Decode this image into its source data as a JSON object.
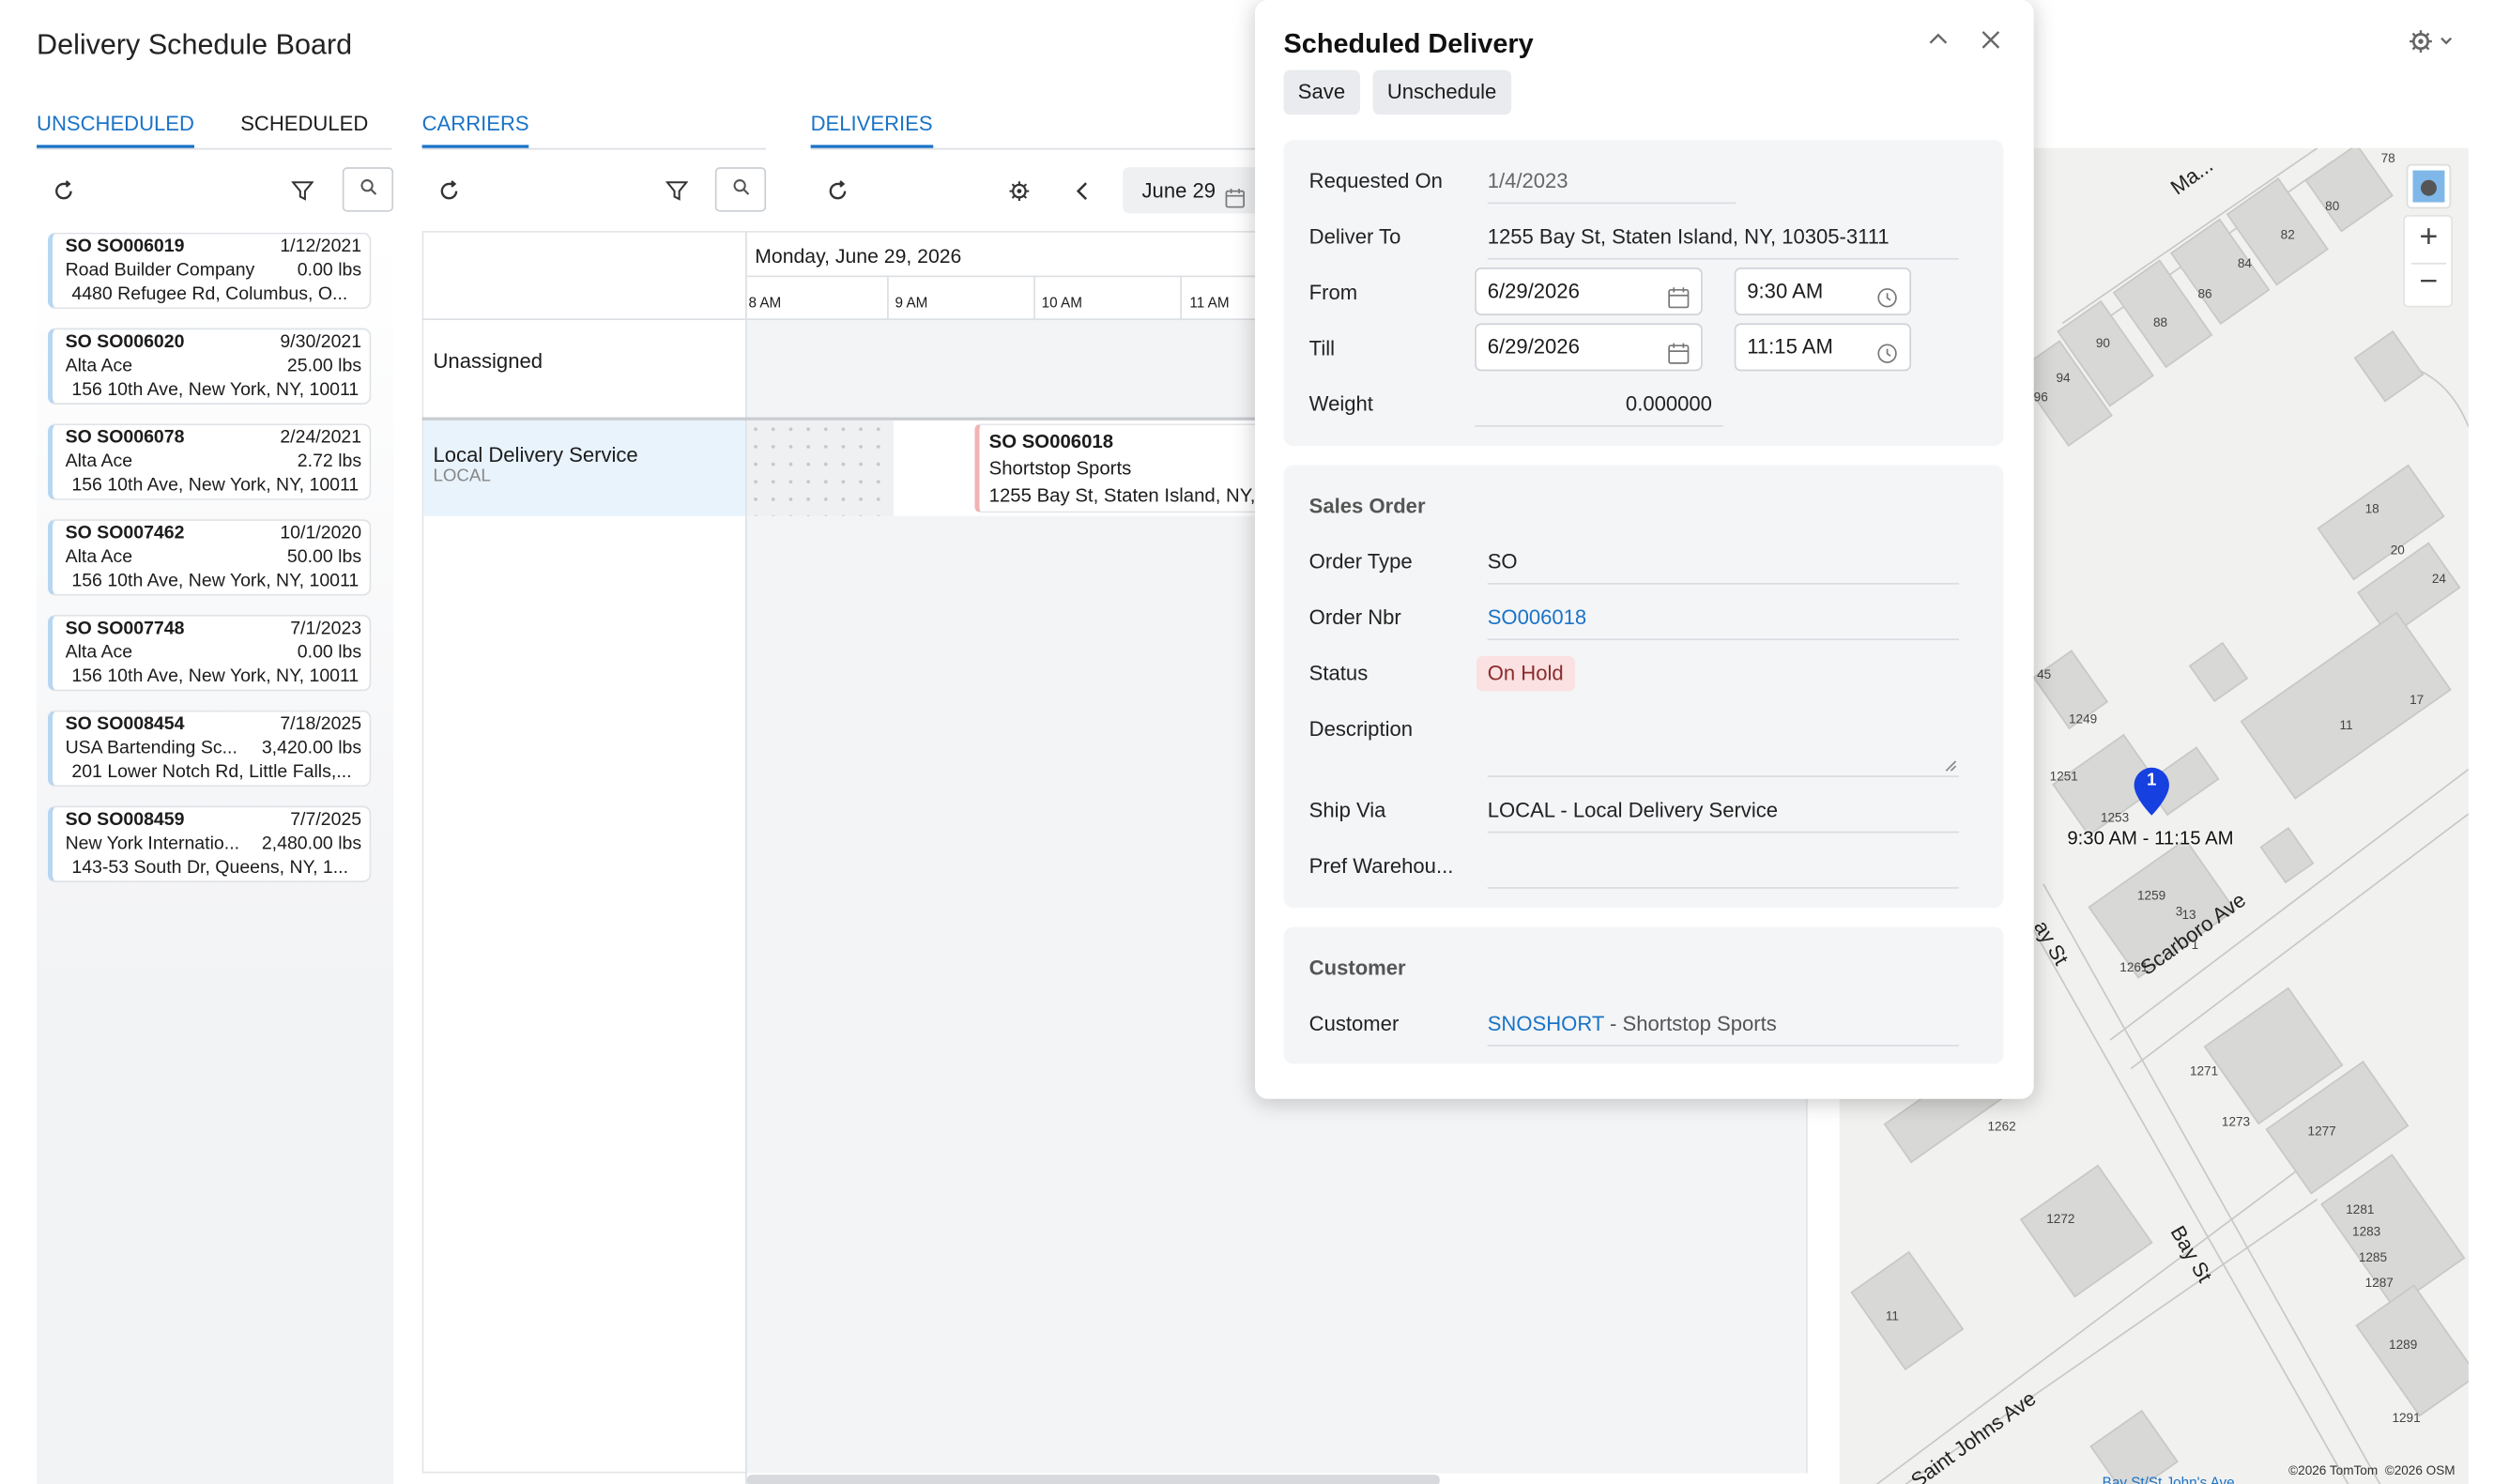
{
  "app": {
    "title": "Delivery Schedule Board"
  },
  "tabs": {
    "unscheduled": "UNSCHEDULED",
    "scheduled": "SCHEDULED",
    "carriers": "CARRIERS",
    "deliveries": "DELIVERIES"
  },
  "icons": {
    "refresh": "refresh-icon",
    "filter": "filter-icon",
    "search": "search-icon",
    "settings": "gear-icon",
    "prev": "chevron-left-icon",
    "calendar": "calendar-icon",
    "clock": "clock-icon",
    "collapse": "chevron-up-icon",
    "close": "close-icon",
    "zoom_in": "plus-icon",
    "zoom_out": "minus-icon",
    "pin": "map-pin-icon"
  },
  "colors": {
    "accent": "#1a73c7",
    "status_hold_bg": "#fbe1e1",
    "pin": "#1640e0"
  },
  "orders": [
    {
      "id": "SO SO006019",
      "date": "1/12/2021",
      "customer": "Road Builder Company",
      "weight": "0.00 lbs",
      "address": "4480 Refugee Rd, Columbus, O..."
    },
    {
      "id": "SO SO006020",
      "date": "9/30/2021",
      "customer": "Alta Ace",
      "weight": "25.00 lbs",
      "address": "156 10th Ave, New York, NY, 10011"
    },
    {
      "id": "SO SO006078",
      "date": "2/24/2021",
      "customer": "Alta Ace",
      "weight": "2.72 lbs",
      "address": "156 10th Ave, New York, NY, 10011"
    },
    {
      "id": "SO SO007462",
      "date": "10/1/2020",
      "customer": "Alta Ace",
      "weight": "50.00 lbs",
      "address": "156 10th Ave, New York, NY, 10011"
    },
    {
      "id": "SO SO007748",
      "date": "7/1/2023",
      "customer": "Alta Ace",
      "weight": "0.00 lbs",
      "address": "156 10th Ave, New York, NY, 10011"
    },
    {
      "id": "SO SO008454",
      "date": "7/18/2025",
      "customer": "USA Bartending Sc...",
      "weight": "3,420.00 lbs",
      "address": "201 Lower Notch Rd, Little Falls,..."
    },
    {
      "id": "SO SO008459",
      "date": "7/7/2025",
      "customer": "New York Internatio...",
      "weight": "2,480.00 lbs",
      "address": "143-53 South Dr, Queens, NY, 1..."
    }
  ],
  "carriers": [
    {
      "name": "Unassigned",
      "code": ""
    },
    {
      "name": "Local Delivery Service",
      "code": "LOCAL"
    }
  ],
  "board": {
    "date_button": "June 29",
    "day_header": "Monday, June 29, 2026",
    "hours": [
      "8 AM",
      "9 AM",
      "10 AM",
      "11 AM"
    ],
    "event": {
      "id": "SO SO006018",
      "customer": "Shortstop Sports",
      "address": "1255 Bay St, Staten Island, NY,"
    }
  },
  "dialog": {
    "title": "Scheduled Delivery",
    "save": "Save",
    "unschedule": "Unschedule",
    "requested_on_label": "Requested On",
    "requested_on": "1/4/2023",
    "deliver_to_label": "Deliver To",
    "deliver_to": "1255 Bay St, Staten Island, NY, 10305-3111",
    "from_label": "From",
    "from_date": "6/29/2026",
    "from_time": "9:30 AM",
    "till_label": "Till",
    "till_date": "6/29/2026",
    "till_time": "11:15 AM",
    "weight_label": "Weight",
    "weight": "0.000000",
    "sales_order_heading": "Sales Order",
    "order_type_label": "Order Type",
    "order_type": "SO",
    "order_nbr_label": "Order Nbr",
    "order_nbr": "SO006018",
    "status_label": "Status",
    "status": "On Hold",
    "description_label": "Description",
    "ship_via_label": "Ship Via",
    "ship_via": "LOCAL - Local Delivery Service",
    "pref_warehouse_label": "Pref Warehou...",
    "customer_heading": "Customer",
    "customer_label": "Customer",
    "customer_code": "SNOSHORT",
    "customer_name": " - Shortstop Sports"
  },
  "map": {
    "pin_number": "1",
    "pin_time": "9:30 AM - 11:15 AM",
    "streets": [
      "Scarboro Ave",
      "Bay St",
      "Saint Johns Ave",
      "Bay St",
      "Ma..."
    ],
    "numbers": [
      "78",
      "80",
      "82",
      "84",
      "86",
      "88",
      "90",
      "94",
      "96",
      "18",
      "20",
      "24",
      "17",
      "11",
      "45",
      "1249",
      "1251",
      "1253",
      "1259",
      "13",
      "3",
      "1",
      "1261",
      "1271",
      "1273",
      "1277",
      "1262",
      "1272",
      "1281",
      "1283",
      "1285",
      "1287",
      "1289",
      "1291",
      "11"
    ],
    "attribution": "©2026 TomTom  ©2026 OSM",
    "bottom_link": "Bay St/St John's Ave"
  }
}
